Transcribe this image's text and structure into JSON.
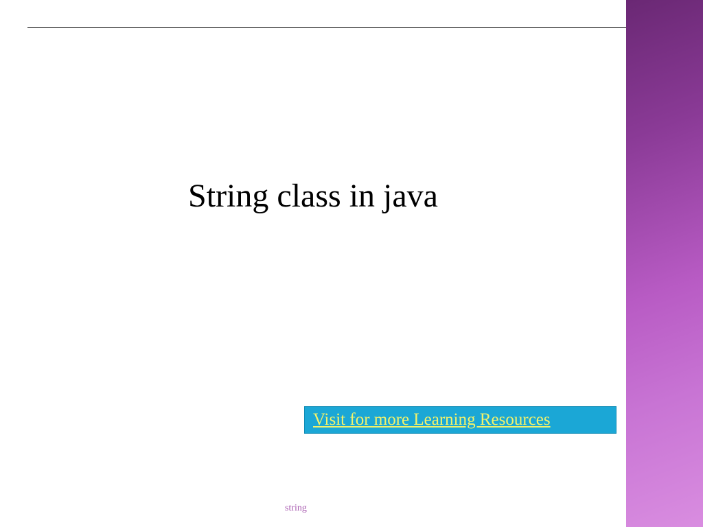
{
  "title": "String class in java",
  "link": {
    "label": "Visit for more Learning Resources"
  },
  "footer": {
    "label": "string"
  }
}
